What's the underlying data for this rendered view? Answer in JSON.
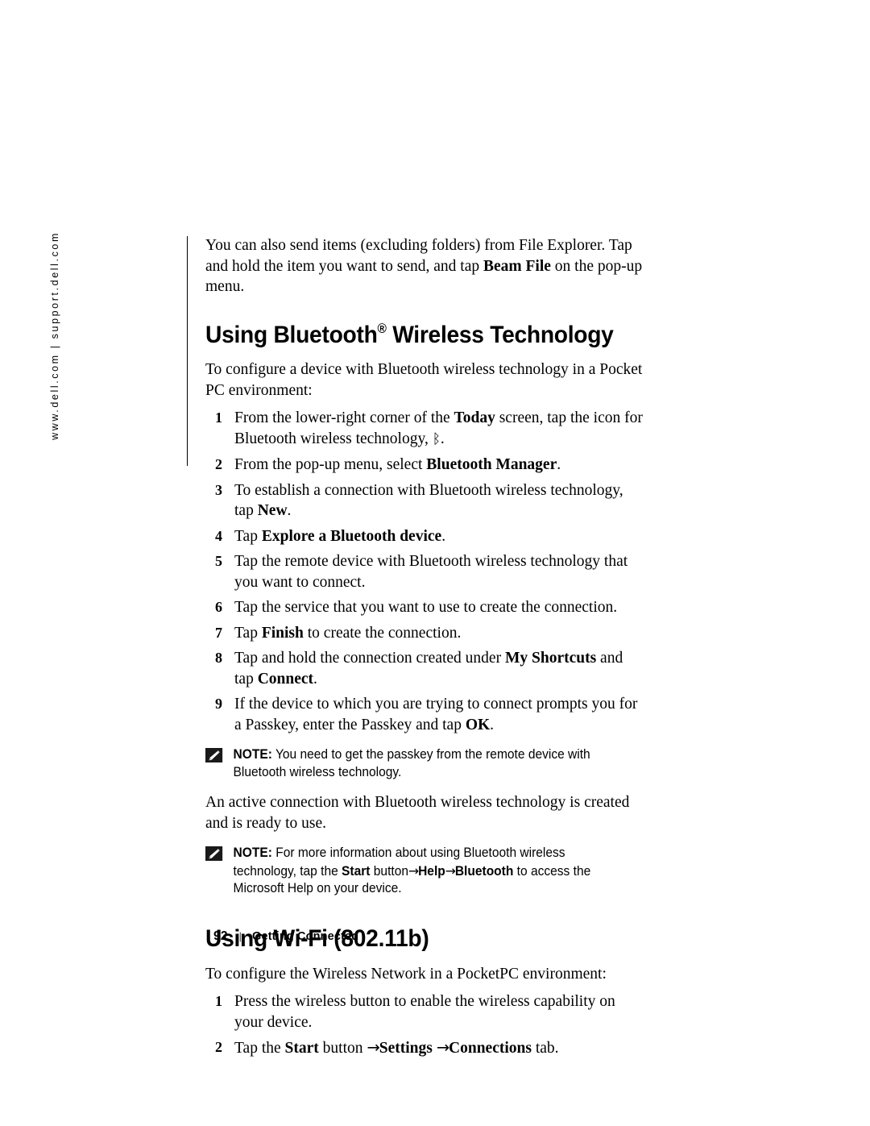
{
  "sidebar": {
    "url_text": "www.dell.com | support.dell.com"
  },
  "intro_paragraph": {
    "part1": "You can also send items (excluding folders) from File Explorer. Tap and hold the item you want to send, and tap ",
    "bold1": "Beam File",
    "part2": " on the pop-up menu."
  },
  "bluetooth_section": {
    "heading_pre": "Using Bluetooth",
    "heading_sup": "®",
    "heading_post": " Wireless Technology",
    "lead": "To configure a device with Bluetooth wireless technology in a Pocket PC environment:",
    "steps": [
      {
        "num": "1",
        "pre": "From the lower-right corner of the ",
        "bold": "Today",
        "post": " screen, tap the icon for Bluetooth wireless technology, ",
        "glyph": "ᛒ",
        "tail": "."
      },
      {
        "num": "2",
        "pre": "From the pop-up menu, select ",
        "bold": "Bluetooth Manager",
        "post": ".",
        "glyph": "",
        "tail": ""
      },
      {
        "num": "3",
        "pre": "To establish a connection with Bluetooth wireless technology, tap ",
        "bold": "New",
        "post": ".",
        "glyph": "",
        "tail": ""
      },
      {
        "num": "4",
        "pre": "Tap ",
        "bold": "Explore a Bluetooth device",
        "post": ".",
        "glyph": "",
        "tail": ""
      },
      {
        "num": "5",
        "pre": "Tap the remote device with Bluetooth wireless technology that you want to connect.",
        "bold": "",
        "post": "",
        "glyph": "",
        "tail": ""
      },
      {
        "num": "6",
        "pre": "Tap the service that you want to use to create the connection.",
        "bold": "",
        "post": "",
        "glyph": "",
        "tail": ""
      },
      {
        "num": "7",
        "pre": "Tap ",
        "bold": "Finish",
        "post": " to create the connection.",
        "glyph": "",
        "tail": ""
      },
      {
        "num": "8",
        "pre": "Tap and hold the connection created under ",
        "bold": "My Shortcuts",
        "post": " and tap ",
        "bold2": "Connect",
        "post2": ".",
        "glyph": "",
        "tail": ""
      },
      {
        "num": "9",
        "pre": "If the device to which you are trying to connect prompts you for a Passkey, enter the Passkey and tap ",
        "bold": "OK",
        "post": ".",
        "glyph": "",
        "tail": ""
      }
    ],
    "note1": {
      "label": "NOTE:",
      "text": " You need to get the passkey from the remote device with Bluetooth wireless technology."
    },
    "after_note": "An active connection with Bluetooth wireless technology is created and is ready to use.",
    "note2": {
      "label": "NOTE:",
      "part1": " For more information about using Bluetooth wireless technology, tap the ",
      "bold1": "Start",
      "part2": " button",
      "arrow1": "→",
      "bold2": "Help",
      "arrow2": "→",
      "bold3": "Bluetooth",
      "part3": " to access the Microsoft Help on your device."
    }
  },
  "wifi_section": {
    "heading": "Using Wi-Fi (802.11b)",
    "lead": "To configure the Wireless Network in a PocketPC environment:",
    "steps": [
      {
        "num": "1",
        "pre": "Press the wireless button to enable the wireless capability on your device.",
        "bold": "",
        "post": ""
      },
      {
        "num": "2",
        "pre": "Tap the ",
        "bold": "Start",
        "post": " button ",
        "arrow1": "→",
        "bold2": "Settings",
        "mid": " ",
        "arrow2": "→",
        "bold3": "Connections",
        "post2": " tab."
      }
    ]
  },
  "footer": {
    "page_number": "92",
    "separator": "|",
    "chapter": "Getting Connected"
  }
}
